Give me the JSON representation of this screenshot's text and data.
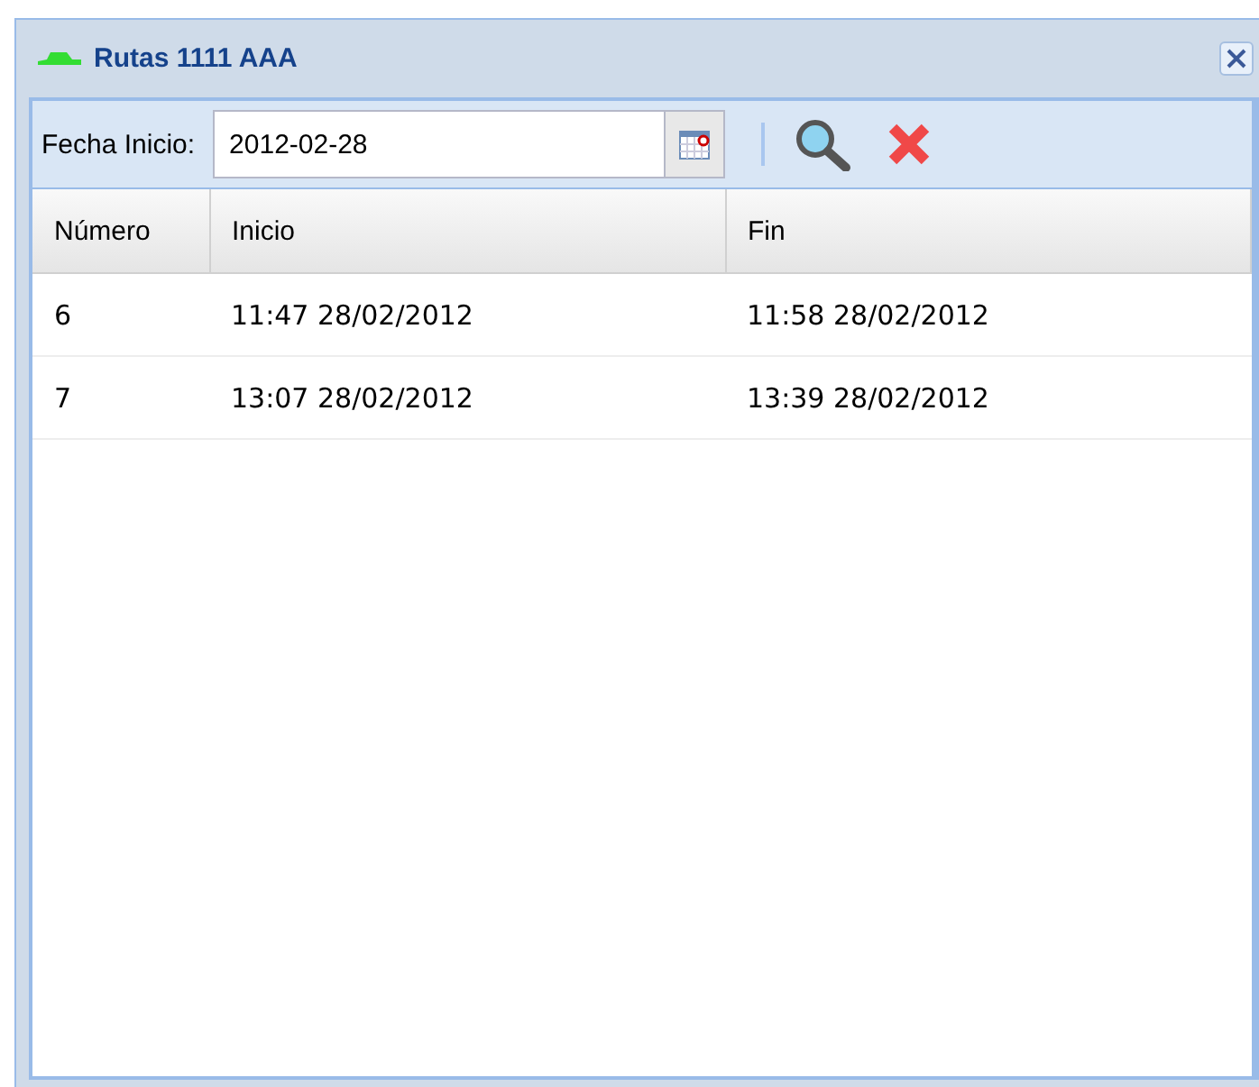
{
  "window": {
    "title": "Rutas 1111 AAA"
  },
  "toolbar": {
    "date_label": "Fecha Inicio:",
    "date_value": "2012-02-28"
  },
  "table": {
    "columns": [
      "Número",
      "Inicio",
      "Fin"
    ],
    "rows": [
      [
        "6",
        "11:47 28/02/2012",
        "11:58 28/02/2012"
      ],
      [
        "7",
        "13:07 28/02/2012",
        "13:39 28/02/2012"
      ]
    ]
  }
}
